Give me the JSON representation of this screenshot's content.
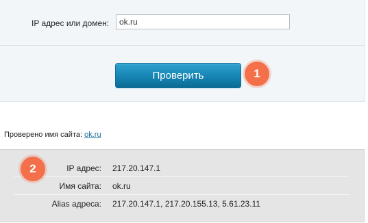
{
  "form": {
    "label": "IP адрес или домен:",
    "input_value": "ok.ru",
    "button_label": "Проверить"
  },
  "badges": {
    "one": "1",
    "two": "2"
  },
  "checked": {
    "prefix": "Проверено имя сайта:",
    "link": "ok.ru"
  },
  "results": [
    {
      "key": "IP адрес:",
      "value": "217.20.147.1"
    },
    {
      "key": "Имя сайта:",
      "value": "ok.ru"
    },
    {
      "key": "Alias адреса:",
      "value": "217.20.147.1, 217.20.155.13, 5.61.23.11"
    }
  ],
  "colors": {
    "accent": "#1887b6",
    "badge": "#f4704a",
    "link": "#1d6f9e"
  }
}
